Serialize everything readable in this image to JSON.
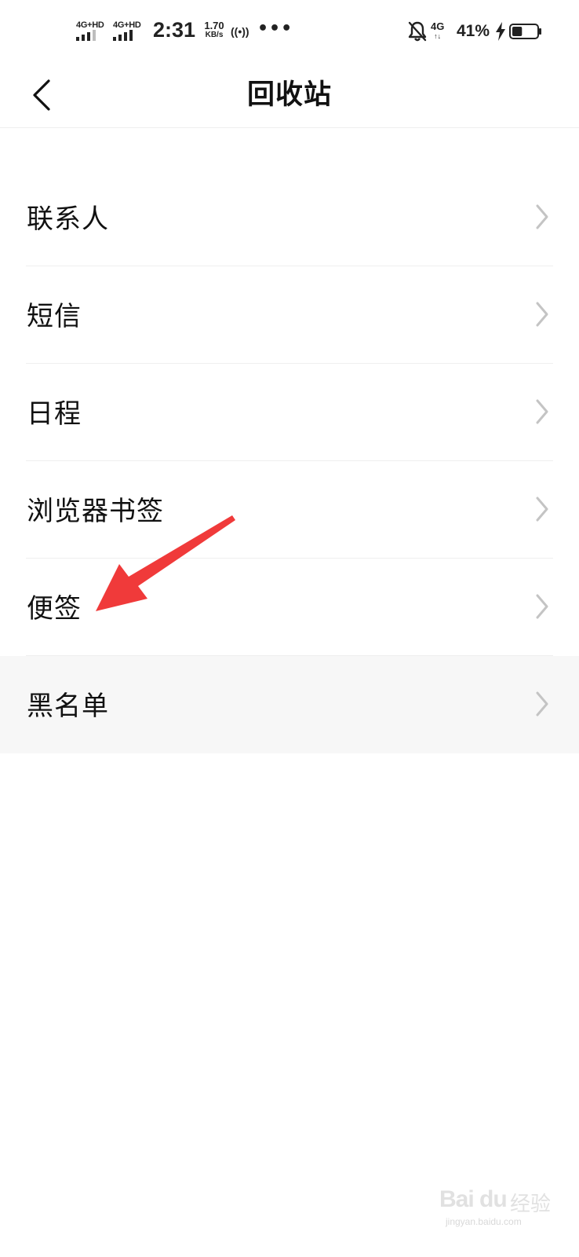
{
  "status_bar": {
    "sim1_label": "4G+HD",
    "sim2_label": "4G+HD",
    "time": "2:31",
    "speed_value": "1.70",
    "speed_unit": "KB/s",
    "hotspot_glyph": "((•))",
    "more_glyph": "•••",
    "network": "4G",
    "network_arrows": "↑↓",
    "battery": "41%",
    "battery_level": 0.41,
    "icons": [
      "signal-icon",
      "hotspot-icon",
      "bell-off-icon",
      "charging-icon",
      "battery-icon"
    ]
  },
  "nav": {
    "back_icon": "chevron-left-icon",
    "title": "回收站"
  },
  "list": {
    "items": [
      {
        "label": "联系人"
      },
      {
        "label": "短信"
      },
      {
        "label": "日程"
      },
      {
        "label": "浏览器书签"
      },
      {
        "label": "便签"
      },
      {
        "label": "黑名单"
      }
    ],
    "chevron_icon": "chevron-right-icon"
  },
  "annotation": {
    "color": "#f03a3a",
    "target": "便签"
  },
  "watermark": {
    "logo": "Bai du",
    "cn": "经验",
    "url": "jingyan.baidu.com"
  },
  "colors": {
    "background": "#ffffff",
    "text": "#111111",
    "divider": "#efefef",
    "chevron": "#c4c4c4",
    "highlight_row": "#f7f7f7"
  }
}
